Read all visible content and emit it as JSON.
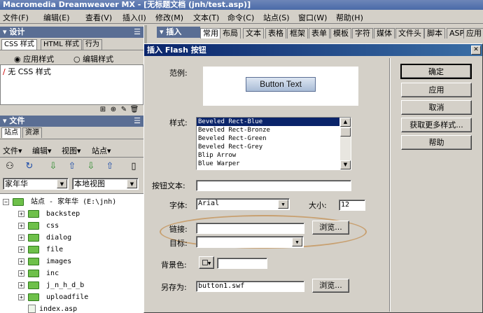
{
  "app": {
    "title": "Macromedia Dreamweaver MX - [无标题文档 (jnh/test.asp)]"
  },
  "menu": [
    "文件(F)",
    "编辑(E)",
    "查看(V)",
    "插入(I)",
    "修改(M)",
    "文本(T)",
    "命令(C)",
    "站点(S)",
    "窗口(W)",
    "帮助(H)"
  ],
  "design_panel": {
    "title": "设计",
    "tabs": [
      "CSS 样式",
      "HTML 样式",
      "行为"
    ],
    "radio_apply": "应用样式",
    "radio_edit": "编辑样式",
    "style_item": "无 CSS 样式"
  },
  "files_panel": {
    "title": "文件",
    "tabs": [
      "站点",
      "资源"
    ],
    "menu": [
      "文件▾",
      "编辑▾",
      "视图▾",
      "站点▾"
    ],
    "site_select": "家年华",
    "view_select": "本地视图",
    "root": "站点 - 家年华 (E:\\jnh)",
    "folders": [
      "backstep",
      "css",
      "dialog",
      "file",
      "images",
      "inc",
      "j_n_h_d_b",
      "uploadfile"
    ],
    "files": [
      "index.asp"
    ]
  },
  "insert_bar": {
    "title": "插入",
    "tabs": [
      "常用",
      "布局",
      "文本",
      "表格",
      "框架",
      "表单",
      "模板",
      "字符",
      "媒体",
      "文件头",
      "脚本",
      "ASP",
      "应用"
    ]
  },
  "dialog": {
    "title": "插入 Flash 按钮",
    "example_label": "范例:",
    "example_button": "Button Text",
    "style_label": "样式:",
    "styles": [
      "Beveled Rect-Blue",
      "Beveled Rect-Bronze",
      "Beveled Rect-Green",
      "Beveled Rect-Grey",
      "Blip Arrow",
      "Blue Warper"
    ],
    "button_text_label": "按钮文本:",
    "button_text_value": "",
    "font_label": "字体:",
    "font_value": "Arial",
    "size_label": "大小:",
    "size_value": "12",
    "link_label": "链接:",
    "link_value": "",
    "target_label": "目标:",
    "target_value": "",
    "browse_label": "浏览...",
    "bgcolor_label": "背景色:",
    "bgcolor_value": "",
    "saveas_label": "另存为:",
    "saveas_value": "button1.swf",
    "ok": "确定",
    "apply": "应用",
    "cancel": "取消",
    "more_styles": "获取更多样式...",
    "help": "帮助"
  },
  "colors": {
    "titlebar": "#4a6aa8",
    "panel_head": "#5a6e94",
    "selection": "#0a246a",
    "highlight_oval": "#c8a070",
    "folder": "#6ec04a"
  }
}
